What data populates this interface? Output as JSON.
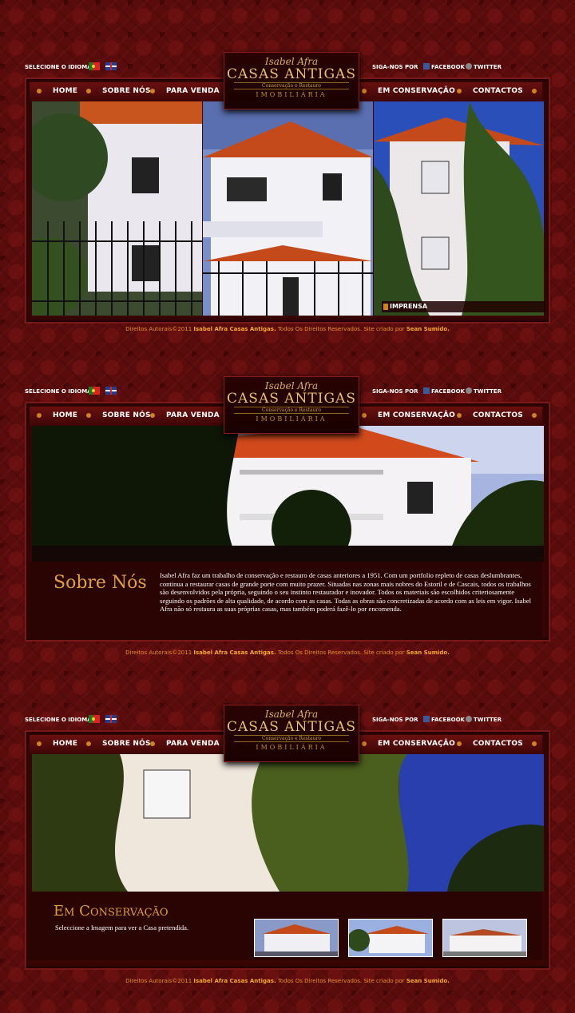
{
  "header": {
    "language_label": "SELECIONE O IDIOMA:",
    "follow_label": "SIGA-NOS POR",
    "facebook": "FACEBOOK",
    "twitter": "TWITTER"
  },
  "logo": {
    "name": "Isabel Afra",
    "brand": "CASAS ANTIGAS",
    "tagline": "Conservação e Restauro",
    "imobiliaria": "IMOBILIÁRIA"
  },
  "nav": {
    "home": "HOME",
    "sobre": "SOBRE NÓS",
    "venda": "PARA VENDA",
    "conservacao": "EM CONSERVAÇÃO",
    "contactos": "CONTACTOS"
  },
  "home": {
    "press_label": "IMPRENSA"
  },
  "about": {
    "title": "Sobre Nós",
    "text": "Isabel Afra faz um trabalho de conservação e restauro de casas anteriores a 1951. Com um portfolio repleto de casas deslumbrantes, continua a restaurar casas de grande porte com muito prazer. Situadas nas zonas mais nobres do Estoril e de Cascais, todos os trabalhos são desenvolvidos pela própria, seguindo o seu instinto restaurador e inovador. Todos os materiais são escolhidos criteriosamente seguindo os padrões de alta qualidade, de acordo com as casas. Todas as obras são concretizadas de acordo com as leis em vigor. Isabel Afra não só restaura as suas próprias casas, mas também poderá fazê-lo por encomenda."
  },
  "conservation": {
    "title": "Em Conservação",
    "subtitle": "Seleccione a Imagem para ver a Casa pretendida."
  },
  "footer": {
    "prefix": "Direitos Autorais©2011 ",
    "company": "Isabel Afra Casas Antigas.",
    "middle": " Todos Os Direitos Reservados. Site criado por ",
    "author": "Sean Sumido."
  }
}
